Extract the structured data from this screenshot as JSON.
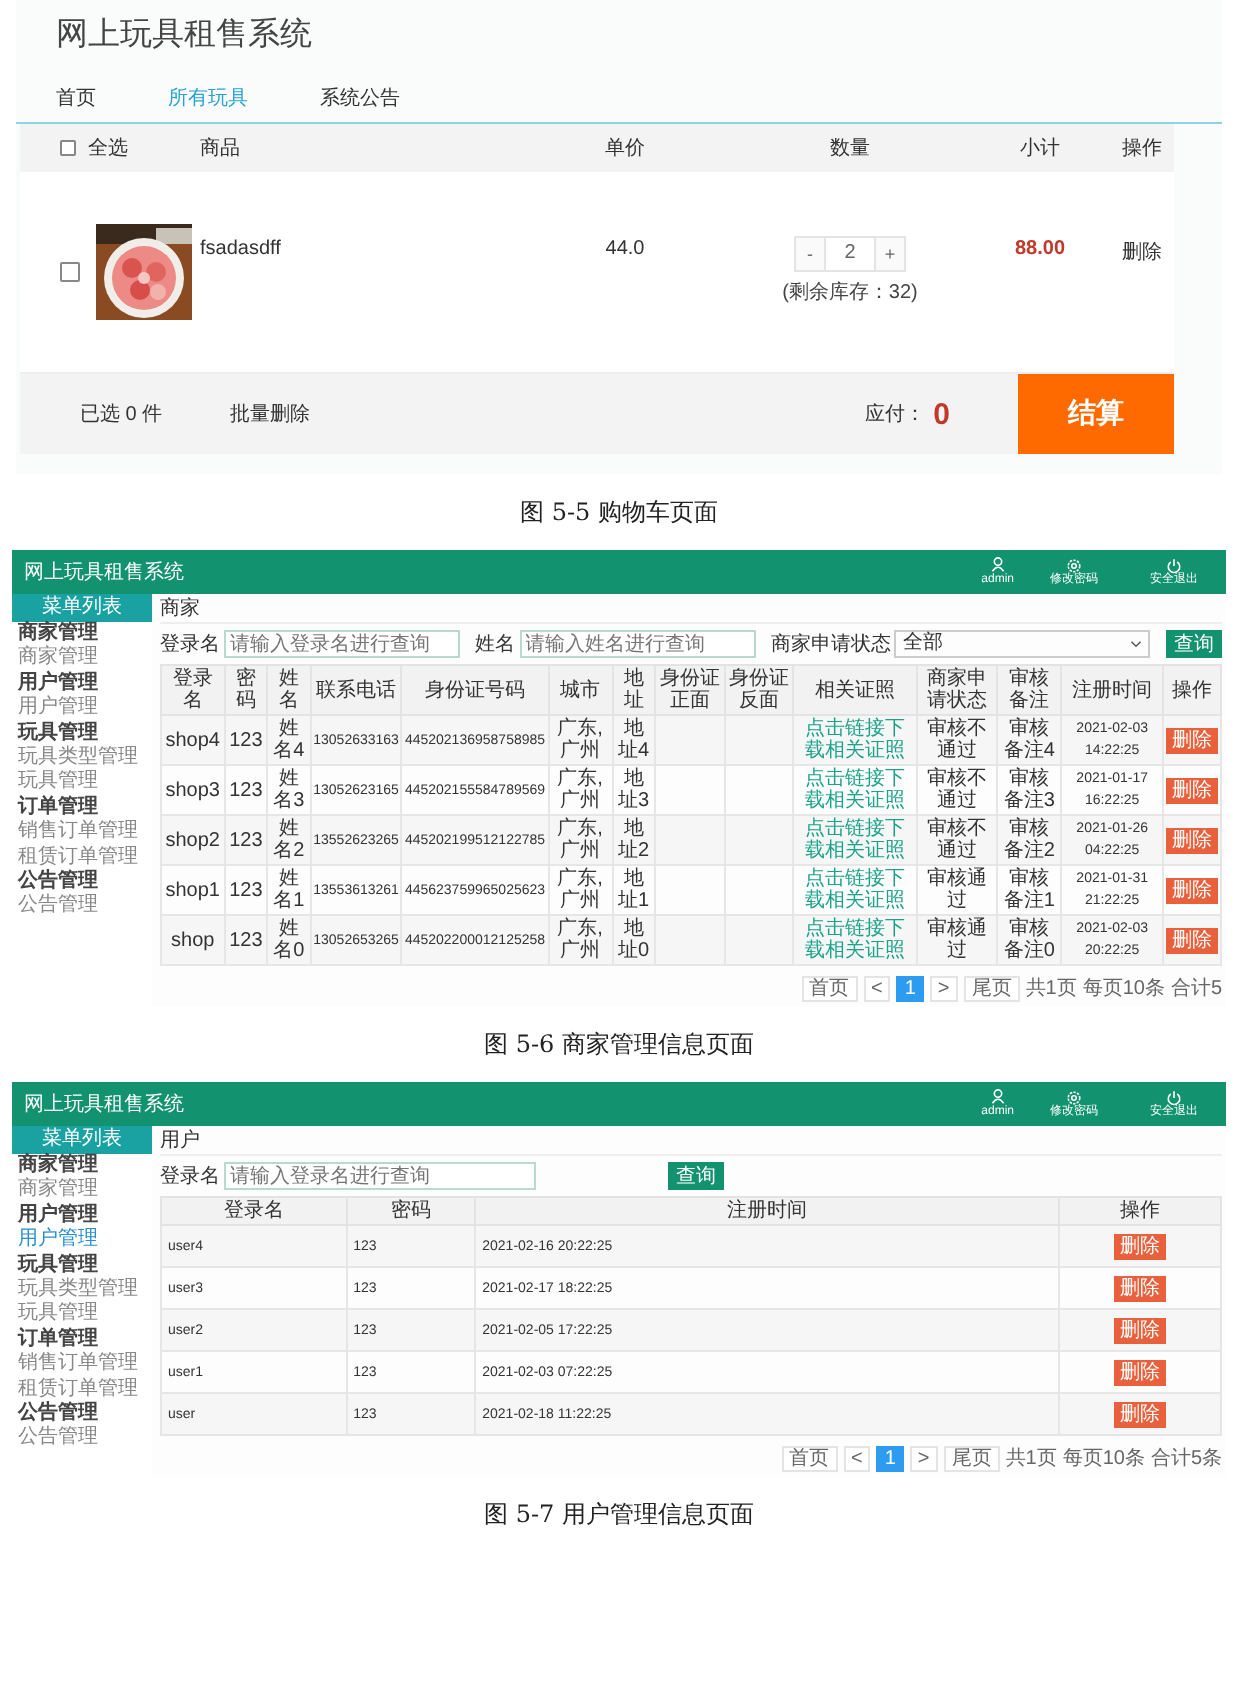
{
  "cart_page": {
    "title": "网上玩具租售系统",
    "nav": [
      {
        "label": "首页",
        "selected": false
      },
      {
        "label": "所有玩具",
        "selected": true
      },
      {
        "label": "系统公告",
        "selected": false
      }
    ],
    "select_all": {
      "label": "全选",
      "checked": false
    },
    "columns": [
      "商品",
      "单价",
      "数量",
      "小计",
      "操作"
    ],
    "items": [
      {
        "checked": false,
        "name": "fsadasdff",
        "price": "44.0",
        "decrease": "-",
        "quantity": "2",
        "increase": "+",
        "stock_note": "(剩余库存：32)",
        "subtotal": "88.00",
        "action": "删除"
      }
    ],
    "footer": {
      "selected_count": "已选 0 件",
      "batch_delete": "批量删除",
      "payable_label": "应付：",
      "payable": "0",
      "checkout": "结算"
    },
    "caption": "图 5-5 购物车页面"
  },
  "admin_figures": [
    {
      "kind": "merchant",
      "system_title": "网上玩具租售系统",
      "header_actions": [
        {
          "label": "admin",
          "kind": "user"
        },
        {
          "label": "修改密码",
          "kind": "gear"
        },
        {
          "label": "安全退出",
          "kind": "power"
        }
      ],
      "menu_title": "菜单列表",
      "menu": [
        {
          "label": "商家管理",
          "children": [
            {
              "label": "商家管理",
              "selected": false
            }
          ]
        },
        {
          "label": "用户管理",
          "children": [
            {
              "label": "用户管理",
              "selected": false
            }
          ]
        },
        {
          "label": "玩具管理",
          "children": [
            {
              "label": "玩具类型管理",
              "selected": false
            },
            {
              "label": "玩具管理",
              "selected": false
            }
          ]
        },
        {
          "label": "订单管理",
          "children": [
            {
              "label": "销售订单管理",
              "selected": false
            },
            {
              "label": "租赁订单管理",
              "selected": false
            }
          ]
        },
        {
          "label": "公告管理",
          "children": [
            {
              "label": "公告管理",
              "selected": false
            }
          ]
        }
      ],
      "breadcrumb": "商家",
      "filters": [
        {
          "kind": "input",
          "label": "登录名",
          "placeholder": "请输入登录名进行查询"
        },
        {
          "kind": "input",
          "label": "姓名",
          "placeholder": "请输入姓名进行查询"
        },
        {
          "kind": "select",
          "label": "商家申请状态",
          "value": "全部"
        }
      ],
      "search_button": "查询",
      "columns": [
        "登录名",
        "密码",
        "姓名",
        "联系电话",
        "身份证号码",
        "城市",
        "地址",
        "身份证正面",
        "身份证反面",
        "相关证照",
        "商家申请状态",
        "审核备注",
        "注册时间",
        "操作"
      ],
      "rows": [
        {
          "login": "shop4",
          "password": "123",
          "name": "姓名4",
          "phone": "13052633163",
          "id_number": "445202136958758985",
          "city": "广东,广州",
          "address": "地址4",
          "license": "点击链接下载相关证照",
          "status": "审核不通过",
          "remark": "审核备注4",
          "registered": "2021-02-03 14:22:25",
          "action": "删除"
        },
        {
          "login": "shop3",
          "password": "123",
          "name": "姓名3",
          "phone": "13052623165",
          "id_number": "445202155584789569",
          "city": "广东,广州",
          "address": "地址3",
          "license": "点击链接下载相关证照",
          "status": "审核不通过",
          "remark": "审核备注3",
          "registered": "2021-01-17 16:22:25",
          "action": "删除"
        },
        {
          "login": "shop2",
          "password": "123",
          "name": "姓名2",
          "phone": "13552623265",
          "id_number": "445202199512122785",
          "city": "广东,广州",
          "address": "地址2",
          "license": "点击链接下载相关证照",
          "status": "审核不通过",
          "remark": "审核备注2",
          "registered": "2021-01-26 04:22:25",
          "action": "删除"
        },
        {
          "login": "shop1",
          "password": "123",
          "name": "姓名1",
          "phone": "13553613261",
          "id_number": "445623759965025623",
          "city": "广东,广州",
          "address": "地址1",
          "license": "点击链接下载相关证照",
          "status": "审核通过",
          "remark": "审核备注1",
          "registered": "2021-01-31 21:22:25",
          "action": "删除"
        },
        {
          "login": "shop",
          "password": "123",
          "name": "姓名0",
          "phone": "13052653265",
          "id_number": "445202200012125258",
          "city": "广东,广州",
          "address": "地址0",
          "license": "点击链接下载相关证照",
          "status": "审核通过",
          "remark": "审核备注0",
          "registered": "2021-02-03 20:22:25",
          "action": "删除"
        }
      ],
      "pagination": {
        "first": "首页",
        "prev": "<",
        "pages": [
          {
            "label": "1",
            "selected": true
          }
        ],
        "next": ">",
        "last": "尾页",
        "summary": [
          "共1页",
          "每页10条",
          "合计5"
        ]
      },
      "caption": "图 5-6 商家管理信息页面"
    },
    {
      "kind": "user",
      "system_title": "网上玩具租售系统",
      "header_actions": [
        {
          "label": "admin",
          "kind": "user"
        },
        {
          "label": "修改密码",
          "kind": "gear"
        },
        {
          "label": "安全退出",
          "kind": "power"
        }
      ],
      "menu_title": "菜单列表",
      "menu": [
        {
          "label": "商家管理",
          "children": [
            {
              "label": "商家管理",
              "selected": false
            }
          ]
        },
        {
          "label": "用户管理",
          "children": [
            {
              "label": "用户管理",
              "selected": true
            }
          ]
        },
        {
          "label": "玩具管理",
          "children": [
            {
              "label": "玩具类型管理",
              "selected": false
            },
            {
              "label": "玩具管理",
              "selected": false
            }
          ]
        },
        {
          "label": "订单管理",
          "children": [
            {
              "label": "销售订单管理",
              "selected": false
            },
            {
              "label": "租赁订单管理",
              "selected": false
            }
          ]
        },
        {
          "label": "公告管理",
          "children": [
            {
              "label": "公告管理",
              "selected": false
            }
          ]
        }
      ],
      "breadcrumb": "用户",
      "filters": [
        {
          "kind": "input",
          "label": "登录名",
          "placeholder": "请输入登录名进行查询"
        }
      ],
      "search_button": "查询",
      "columns": [
        "登录名",
        "密码",
        "注册时间",
        "操作"
      ],
      "rows": [
        {
          "login": "user4",
          "password": "123",
          "registered": "2021-02-16 20:22:25",
          "action": "删除"
        },
        {
          "login": "user3",
          "password": "123",
          "registered": "2021-02-17 18:22:25",
          "action": "删除"
        },
        {
          "login": "user2",
          "password": "123",
          "registered": "2021-02-05 17:22:25",
          "action": "删除"
        },
        {
          "login": "user1",
          "password": "123",
          "registered": "2021-02-03 07:22:25",
          "action": "删除"
        },
        {
          "login": "user",
          "password": "123",
          "registered": "2021-02-18 11:22:25",
          "action": "删除"
        }
      ],
      "pagination": {
        "first": "首页",
        "prev": "<",
        "pages": [
          {
            "label": "1",
            "selected": true
          }
        ],
        "next": ">",
        "last": "尾页",
        "summary": [
          "共1页",
          "每页10条",
          "合计5条"
        ]
      },
      "caption": "图 5-7 用户管理信息页面"
    }
  ]
}
